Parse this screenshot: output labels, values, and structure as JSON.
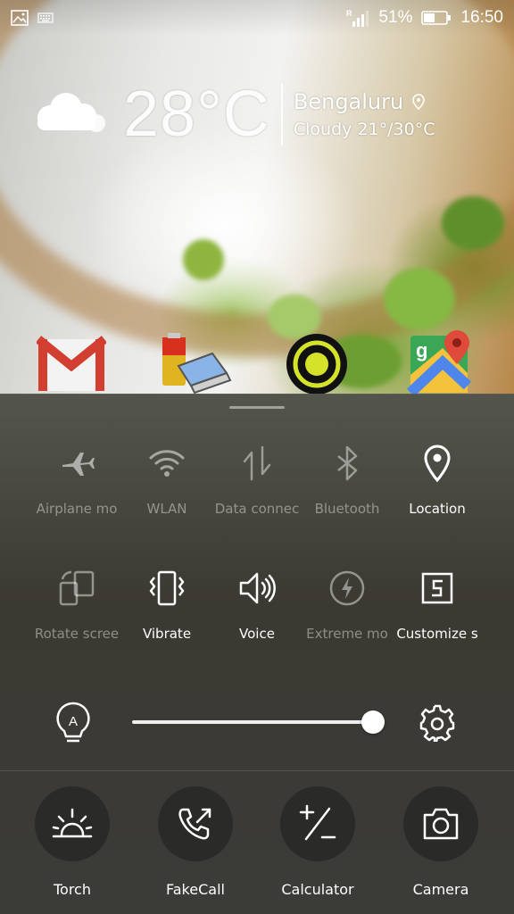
{
  "status_bar": {
    "battery_percent": "51%",
    "battery_level": 0.51,
    "time": "16:50",
    "roaming_indicator": "R",
    "left_icons": [
      "image-notification-icon",
      "keyboard-icon"
    ]
  },
  "weather": {
    "temperature": "28°C",
    "city": "Bengaluru",
    "condition": "Cloudy",
    "range": "21°/30°C"
  },
  "home_apps": [
    "gmail-app-icon",
    "battery-app-icon",
    "ola-app-icon",
    "maps-app-icon"
  ],
  "toggles": [
    {
      "label": "Airplane mo",
      "icon": "airplane-icon",
      "active": false
    },
    {
      "label": "WLAN",
      "icon": "wifi-icon",
      "active": false
    },
    {
      "label": "Data connec",
      "icon": "data-arrows-icon",
      "active": false
    },
    {
      "label": "Bluetooth",
      "icon": "bluetooth-icon",
      "active": false
    },
    {
      "label": "Location",
      "icon": "location-pin-icon",
      "active": true
    },
    {
      "label": "Rotate scree",
      "icon": "rotate-icon",
      "active": false
    },
    {
      "label": "Vibrate",
      "icon": "vibrate-icon",
      "active": true
    },
    {
      "label": "Voice",
      "icon": "speaker-icon",
      "active": true
    },
    {
      "label": "Extreme mo",
      "icon": "power-saver-icon",
      "active": false
    },
    {
      "label": "Customize s",
      "icon": "screenshot-icon",
      "active": true
    }
  ],
  "brightness": {
    "auto": true,
    "level": 1.0
  },
  "shortcuts": [
    {
      "label": "Torch",
      "icon": "sunrise-icon"
    },
    {
      "label": "FakeCall",
      "icon": "phone-call-icon"
    },
    {
      "label": "Calculator",
      "icon": "calculator-icon"
    },
    {
      "label": "Camera",
      "icon": "camera-icon"
    }
  ]
}
